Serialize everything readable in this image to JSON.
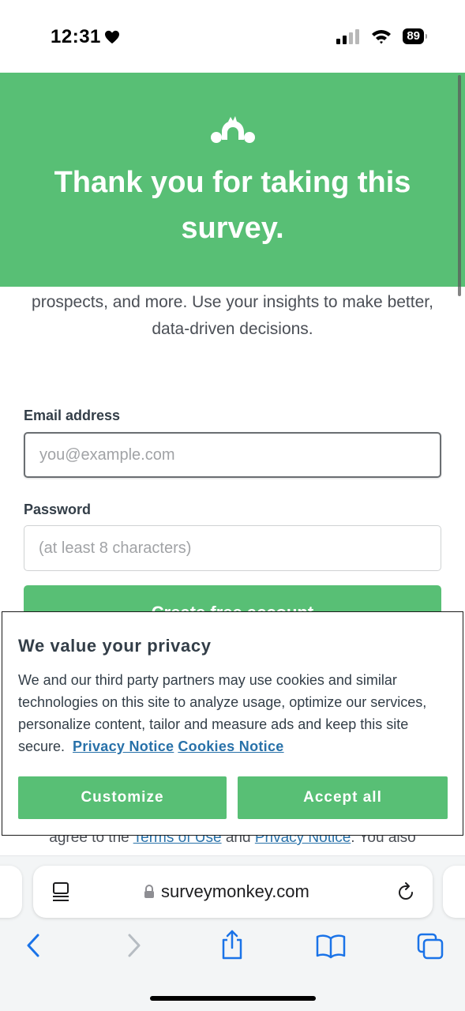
{
  "status_bar": {
    "time": "12:31",
    "battery": "89"
  },
  "header": {
    "title": "Thank you for taking this survey."
  },
  "intro": {
    "text": "prospects, and more. Use your insights to make better, data-driven decisions."
  },
  "signup_form": {
    "email_label": "Email address",
    "email_placeholder": "you@example.com",
    "password_label": "Password",
    "password_placeholder": "(at least 8 characters)",
    "create_button": "Create free account"
  },
  "terms": {
    "prefix": "agree to the ",
    "terms_link": "Terms of Use",
    "middle": " and ",
    "privacy_link": "Privacy Notice",
    "suffix": ". You also"
  },
  "cookie_banner": {
    "title": "We value your privacy",
    "message": "We and our third party partners may use cookies and similar technologies on this site to analyze usage, optimize our services, personalize content, tailor and measure ads and keep this site secure.",
    "privacy_notice_link": "Privacy Notice",
    "cookies_notice_link": "Cookies Notice",
    "customize_button": "Customize",
    "accept_button": "Accept all"
  },
  "browser": {
    "url": "surveymonkey.com"
  },
  "colors": {
    "brand_green": "#58bf75",
    "link_blue": "#2871a9",
    "ios_blue": "#1a73e8"
  }
}
